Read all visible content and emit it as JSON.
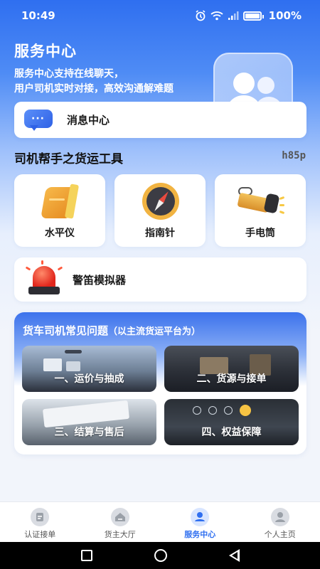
{
  "status_bar": {
    "time": "10:49",
    "battery": "100%",
    "icons": [
      "alarm-icon",
      "wifi-icon",
      "signal-icon",
      "battery-icon"
    ]
  },
  "hero": {
    "title": "服务中心",
    "desc_line1": "服务中心支持在线聊天，",
    "desc_line2": "用户司机实时对接，高效沟通解难题"
  },
  "message_center": {
    "label": "消息中心",
    "icon": "chat-bubble-icon"
  },
  "tools_section": {
    "title": "司机帮手之货运工具",
    "tag": "h85p",
    "tools": [
      {
        "label": "水平仪",
        "icon": "level-tool-icon"
      },
      {
        "label": "指南针",
        "icon": "compass-icon"
      },
      {
        "label": "手电筒",
        "icon": "flashlight-icon"
      }
    ],
    "alarm": {
      "label": "警笛模拟器",
      "icon": "siren-icon"
    }
  },
  "faq": {
    "title": "货车司机常见问题",
    "subtitle": "（以主流货运平台为）",
    "items": [
      {
        "label": "一、运价与抽成"
      },
      {
        "label": "二、货源与接单"
      },
      {
        "label": "三、结算与售后"
      },
      {
        "label": "四、权益保障"
      }
    ]
  },
  "tabbar": {
    "tabs": [
      {
        "label": "认证接单",
        "icon": "verify-order-icon",
        "active": false
      },
      {
        "label": "货主大厅",
        "icon": "shipper-hall-icon",
        "active": false
      },
      {
        "label": "服务中心",
        "icon": "service-center-icon",
        "active": true
      },
      {
        "label": "个人主页",
        "icon": "profile-icon",
        "active": false
      }
    ]
  },
  "colors": {
    "accent": "#2f6ff0",
    "background": "#f2f5fb"
  }
}
